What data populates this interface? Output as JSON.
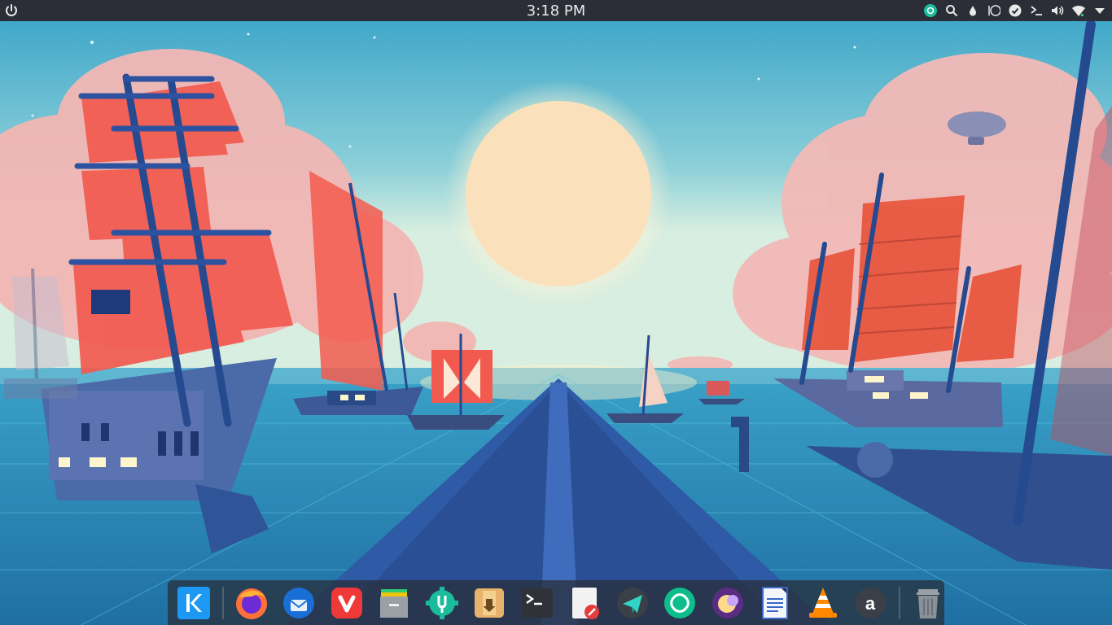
{
  "top_panel": {
    "clock": "3:18 PM",
    "left_icon": "power-icon",
    "tray_icons": [
      "kde-connect-icon",
      "search-icon",
      "color-picker-icon",
      "night-color-icon",
      "updates-icon",
      "terminal-icon",
      "volume-icon",
      "wifi-icon",
      "panel-expand-icon"
    ]
  },
  "dock": {
    "apps": [
      "kde-launcher",
      "firefox",
      "thunderbird",
      "vivaldi",
      "file-manager",
      "system-settings",
      "package-manager",
      "terminal",
      "text-editor",
      "telegram",
      "element",
      "space-app",
      "document-viewer",
      "vlc",
      "amazon"
    ],
    "trash": "trash"
  },
  "colors": {
    "panel_bg": "#2b2e37",
    "sky_top": "#3fa7c9",
    "sky_bottom": "#b7e4e1",
    "sun": "#fbe4bf",
    "sea": "#2d8fbd",
    "sail_red": "#f35a4f"
  }
}
